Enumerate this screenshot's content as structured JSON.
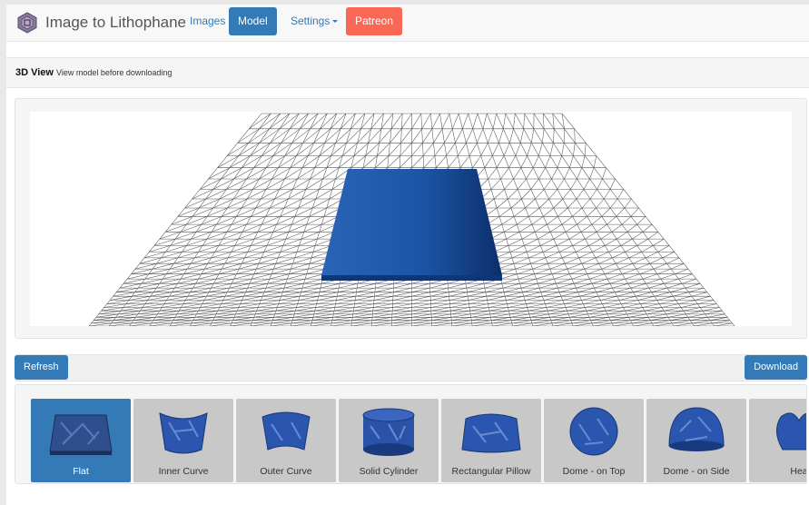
{
  "brand": {
    "title": "Image to Lithophane"
  },
  "nav": {
    "images": "Images",
    "model": "Model",
    "settings": "Settings",
    "patreon": "Patreon"
  },
  "header": {
    "title": "3D View",
    "subtitle": "View model before downloading"
  },
  "toolbar": {
    "refresh": "Refresh",
    "download": "Download"
  },
  "shapes": [
    {
      "label": "Flat",
      "selected": true
    },
    {
      "label": "Inner Curve"
    },
    {
      "label": "Outer Curve"
    },
    {
      "label": "Solid Cylinder"
    },
    {
      "label": "Rectangular Pillow"
    },
    {
      "label": "Dome - on Top"
    },
    {
      "label": "Dome - on Side"
    },
    {
      "label": "Hea"
    }
  ],
  "colors": {
    "primary": "#337ab7",
    "patreon": "#f96854",
    "model": "#1a4f9c"
  }
}
